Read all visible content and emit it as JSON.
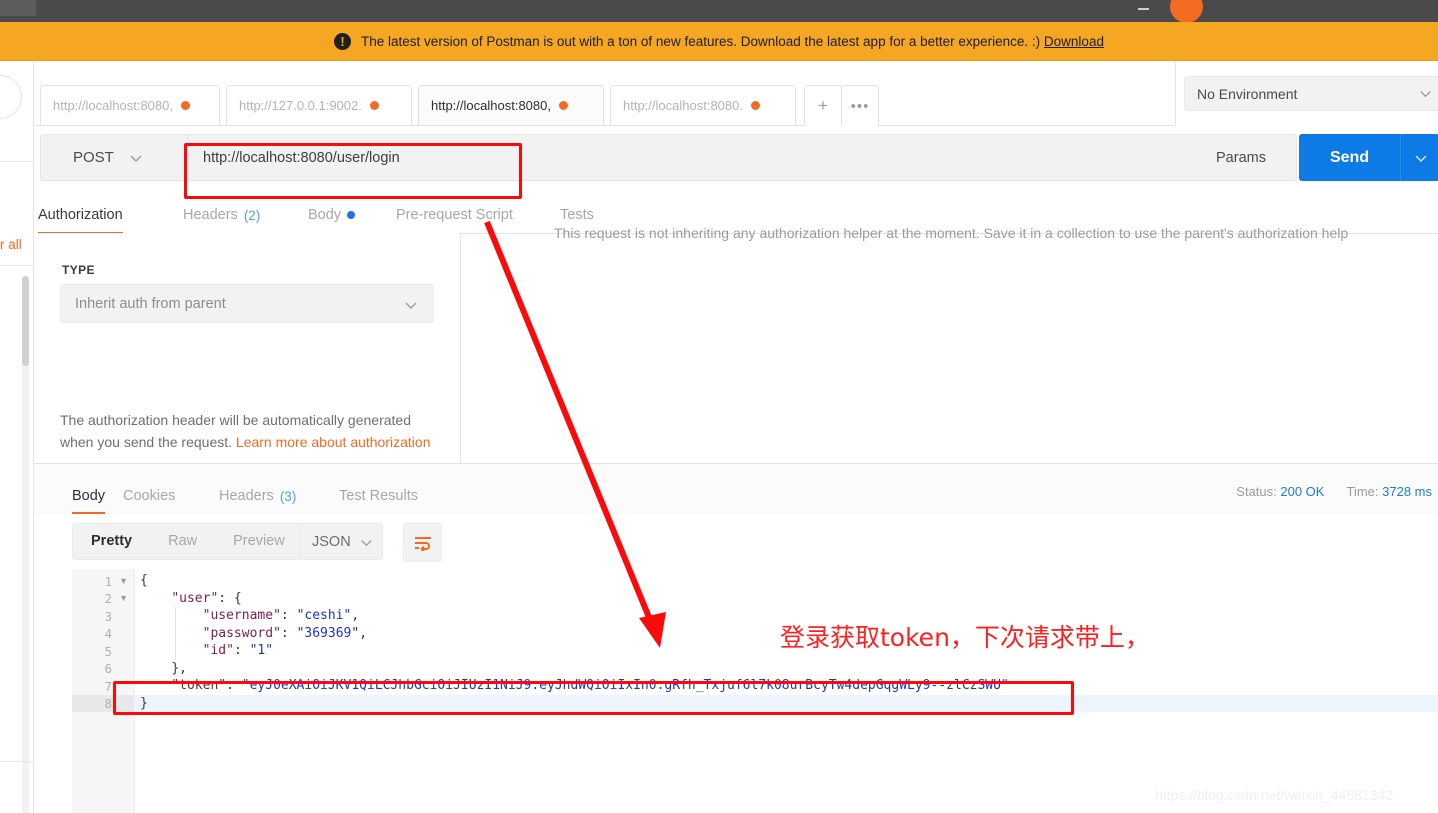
{
  "window": {
    "avatar_initial": "",
    "minimize_label": ""
  },
  "banner": {
    "icon": "alert-icon",
    "text": "The latest version of Postman is out with a ton of new features. Download the latest app for a better experience. :)",
    "link_label": "Download"
  },
  "sidebar": {
    "clear_all_label": "r all"
  },
  "tabs": [
    {
      "label": "http://localhost:8080,",
      "active": false,
      "unsaved": true
    },
    {
      "label": "http://127.0.0.1:9002.",
      "active": false,
      "unsaved": true
    },
    {
      "label": "http://localhost:8080,",
      "active": true,
      "unsaved": true
    },
    {
      "label": "http://localhost:8080.",
      "active": false,
      "unsaved": true
    }
  ],
  "tab_actions": {
    "new_tab_label": "+",
    "more_label": "•••"
  },
  "environment": {
    "selected": "No Environment",
    "chevron_icon": "chevron-down-icon"
  },
  "request": {
    "method": "POST",
    "method_chevron_icon": "chevron-down-icon",
    "url": "http://localhost:8080/user/login",
    "params_label": "Params",
    "send_label": "Send",
    "send_chevron_icon": "chevron-down-icon"
  },
  "request_tabs": [
    {
      "label": "Authorization",
      "active": true,
      "count": "",
      "dot": false
    },
    {
      "label": "Headers",
      "active": false,
      "count": "(2)",
      "dot": false
    },
    {
      "label": "Body",
      "active": false,
      "count": "",
      "dot": true
    },
    {
      "label": "Pre-request Script",
      "active": false,
      "count": "",
      "dot": false
    },
    {
      "label": "Tests",
      "active": false,
      "count": "",
      "dot": false
    }
  ],
  "authorization": {
    "type_label": "TYPE",
    "type_value": "Inherit auth from parent",
    "type_chevron_icon": "chevron-down-icon",
    "help_text": "The authorization header will be automatically generated when you send the request. ",
    "help_link": "Learn more about authorization",
    "inherit_message": "This request is not inheriting any authorization helper at the moment. Save it in a collection to use the parent's authorization help"
  },
  "response_tabs": [
    {
      "label": "Body",
      "active": true,
      "count": ""
    },
    {
      "label": "Cookies",
      "active": false,
      "count": ""
    },
    {
      "label": "Headers",
      "active": false,
      "count": "(3)"
    },
    {
      "label": "Test Results",
      "active": false,
      "count": ""
    }
  ],
  "response_meta": {
    "status_label": "Status:",
    "status_value": "200 OK",
    "time_label": "Time:",
    "time_value": "3728 ms"
  },
  "format_bar": {
    "modes": [
      {
        "label": "Pretty",
        "active": true
      },
      {
        "label": "Raw",
        "active": false
      },
      {
        "label": "Preview",
        "active": false
      }
    ],
    "language": "JSON",
    "language_chevron_icon": "chevron-down-icon",
    "wrap_icon": "word-wrap-icon"
  },
  "response_body": {
    "line_numbers": [
      "1",
      "2",
      "3",
      "4",
      "5",
      "6",
      "7",
      "8"
    ],
    "folded_lines": [
      "1",
      "2"
    ],
    "highlighted_line": "8",
    "lines": [
      {
        "indent": 0,
        "segments": [
          {
            "t": "{",
            "c": "p"
          }
        ]
      },
      {
        "indent": 1,
        "segments": [
          {
            "t": "\"user\"",
            "c": "k"
          },
          {
            "t": ": {",
            "c": "p"
          }
        ]
      },
      {
        "indent": 2,
        "segments": [
          {
            "t": "\"username\"",
            "c": "k"
          },
          {
            "t": ": ",
            "c": "p"
          },
          {
            "t": "\"ceshi\"",
            "c": "v"
          },
          {
            "t": ",",
            "c": "p"
          }
        ]
      },
      {
        "indent": 2,
        "segments": [
          {
            "t": "\"password\"",
            "c": "k"
          },
          {
            "t": ": ",
            "c": "p"
          },
          {
            "t": "\"369369\"",
            "c": "v"
          },
          {
            "t": ",",
            "c": "p"
          }
        ]
      },
      {
        "indent": 2,
        "segments": [
          {
            "t": "\"id\"",
            "c": "k"
          },
          {
            "t": ": ",
            "c": "p"
          },
          {
            "t": "\"1\"",
            "c": "v"
          }
        ]
      },
      {
        "indent": 1,
        "segments": [
          {
            "t": "},",
            "c": "p"
          }
        ]
      },
      {
        "indent": 1,
        "segments": [
          {
            "t": "\"token\"",
            "c": "k"
          },
          {
            "t": ": ",
            "c": "p"
          },
          {
            "t": "\"eyJ0eXAiOiJKV1QiLCJhbGciOiJIUzI1NiJ9.eyJhdWQiOiIxIn0.gRfh_Txjuf6l7k08urBcyTw4depGqgWLy9--zlCzSWU\"",
            "c": "v"
          }
        ]
      },
      {
        "indent": 0,
        "segments": [
          {
            "t": "}",
            "c": "p"
          }
        ]
      }
    ]
  },
  "annotations": {
    "chinese_note": "登录获取token，下次请求带上，",
    "highlight_color": "#fb0a0a"
  },
  "watermark": {
    "text": "https://blog.csdn.net/weixin_44581342"
  }
}
